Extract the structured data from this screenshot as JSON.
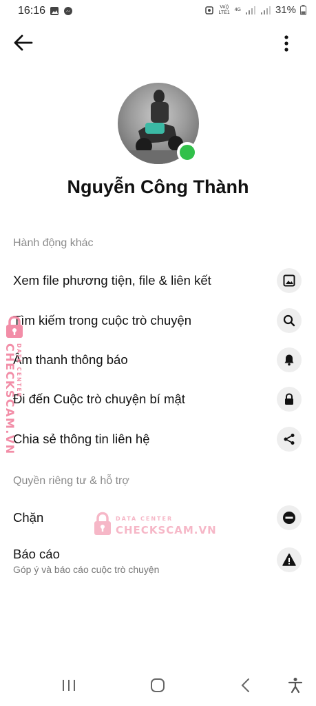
{
  "status_bar": {
    "time": "16:16",
    "volte": "Vo)) LTE1",
    "network": "4G",
    "battery": "31%"
  },
  "header": {
    "back_icon": "arrow-left-icon",
    "more_icon": "more-vertical-icon"
  },
  "profile": {
    "name": "Nguyễn Công Thành",
    "online": true
  },
  "sections": {
    "other_actions": "Hành động khác",
    "privacy": "Quyền riêng tư & hỗ trợ"
  },
  "actions": [
    {
      "label": "Xem file phương tiện, file & liên kết",
      "icon": "image-icon"
    },
    {
      "label": "Tìm kiếm trong cuộc trò chuyện",
      "icon": "search-icon"
    },
    {
      "label": "Âm thanh thông báo",
      "icon": "bell-icon"
    },
    {
      "label": "Đi đến Cuộc trò chuyện bí mật",
      "icon": "lock-icon"
    },
    {
      "label": "Chia sẻ thông tin liên hệ",
      "icon": "share-icon"
    }
  ],
  "privacy_actions": [
    {
      "label": "Chặn",
      "icon": "block-icon"
    },
    {
      "label": "Báo cáo",
      "subtitle": "Góp ý và báo cáo cuộc trò chuyện",
      "icon": "warning-icon"
    }
  ],
  "watermark": {
    "line1": "DATA CENTER",
    "line2": "CHECKSCAM.VN"
  },
  "colors": {
    "online": "#31c04a",
    "icon_bg": "#eeeeee",
    "watermark": "#f28da7"
  }
}
